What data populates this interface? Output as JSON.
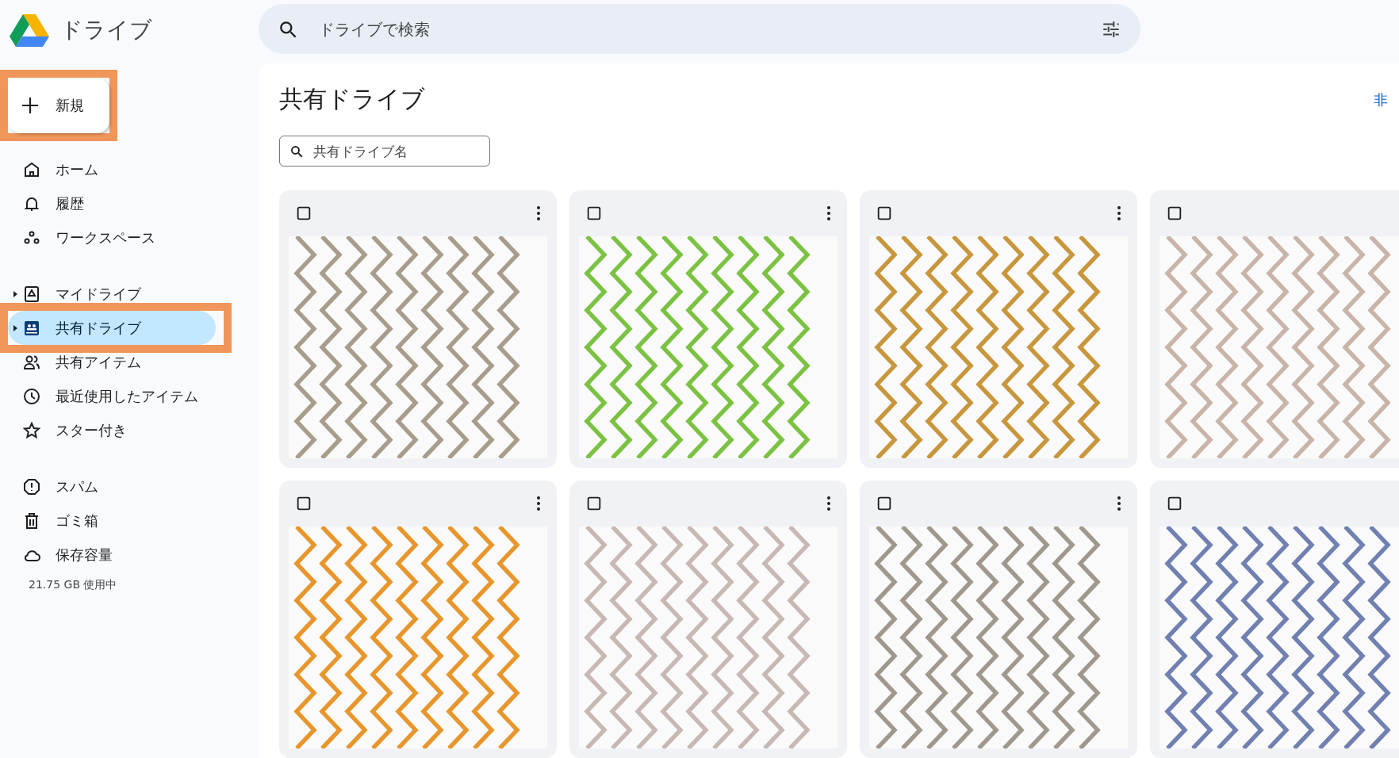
{
  "app": {
    "title": "ドライブ"
  },
  "search": {
    "placeholder": "ドライブで検索"
  },
  "new_button": {
    "label": "新規",
    "annotated": true
  },
  "nav_groups": [
    [
      {
        "kind": "home",
        "label": "ホーム",
        "selected": false,
        "expandable": false,
        "annotated": false
      },
      {
        "kind": "bell",
        "label": "履歴",
        "selected": false,
        "expandable": false,
        "annotated": false
      },
      {
        "kind": "workspace",
        "label": "ワークスペース",
        "selected": false,
        "expandable": false,
        "annotated": false
      }
    ],
    [
      {
        "kind": "mydrive",
        "label": "マイドライブ",
        "selected": false,
        "expandable": true,
        "annotated": false
      },
      {
        "kind": "shared",
        "label": "共有ドライブ",
        "selected": true,
        "expandable": true,
        "annotated": true
      },
      {
        "kind": "people",
        "label": "共有アイテム",
        "selected": false,
        "expandable": false,
        "annotated": false
      },
      {
        "kind": "clock",
        "label": "最近使用したアイテム",
        "selected": false,
        "expandable": false,
        "annotated": false
      },
      {
        "kind": "star",
        "label": "スター付き",
        "selected": false,
        "expandable": false,
        "annotated": false
      }
    ],
    [
      {
        "kind": "spam",
        "label": "スパム",
        "selected": false,
        "expandable": false,
        "annotated": false
      },
      {
        "kind": "trash",
        "label": "ゴミ箱",
        "selected": false,
        "expandable": false,
        "annotated": false
      },
      {
        "kind": "cloud",
        "label": "保存容量",
        "selected": false,
        "expandable": false,
        "annotated": false
      }
    ]
  ],
  "storage": {
    "usage": "21.75 GB 使用中"
  },
  "main": {
    "title": "共有ドライブ",
    "hide_link": "非",
    "filter": {
      "placeholder": "共有ドライブ名"
    }
  },
  "drives": [
    {
      "color": "#a89c8c"
    },
    {
      "color": "#7cc242"
    },
    {
      "color": "#c8963c"
    },
    {
      "color": "#c8b4a8"
    },
    {
      "color": "#e8962c"
    },
    {
      "color": "#c8b8b4"
    },
    {
      "color": "#a0988c"
    },
    {
      "color": "#7080b0"
    }
  ]
}
